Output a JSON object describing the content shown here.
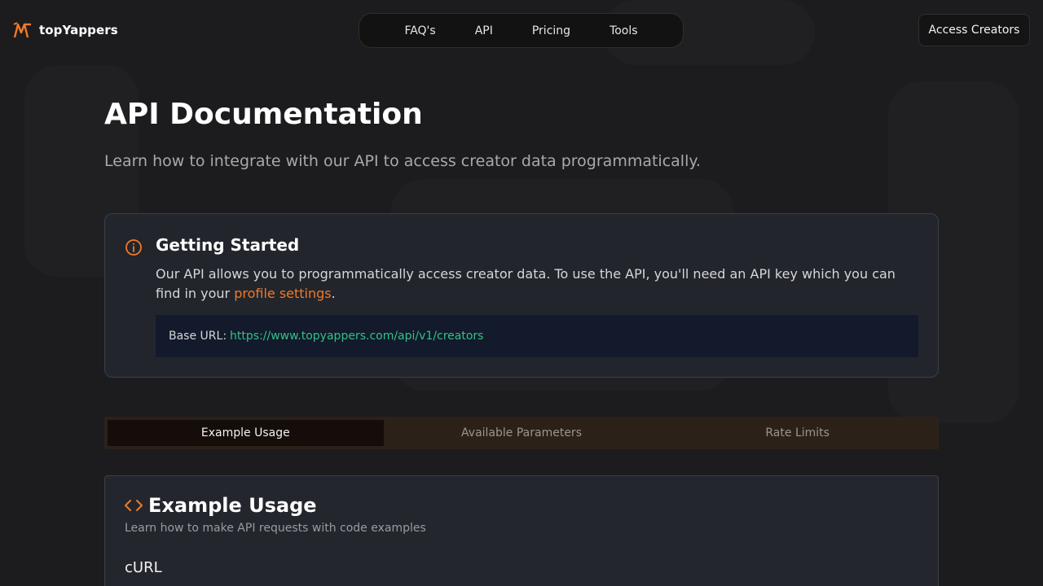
{
  "header": {
    "brand": "topYappers",
    "nav": [
      "FAQ's",
      "API",
      "Pricing",
      "Tools"
    ],
    "cta": "Access Creators"
  },
  "page": {
    "title": "API Documentation",
    "subtitle": "Learn how to integrate with our API to access creator data programmatically."
  },
  "getting_started": {
    "title": "Getting Started",
    "text_before": "Our API allows you to programmatically access creator data. To use the API, you'll need an API key which you can find in your ",
    "link": "profile settings",
    "text_after": ".",
    "base_url_label": "Base URL:",
    "base_url": "https://www.topyappers.com/api/v1/creators"
  },
  "tabs": [
    {
      "label": "Example Usage",
      "active": true
    },
    {
      "label": "Available Parameters",
      "active": false
    },
    {
      "label": "Rate Limits",
      "active": false
    }
  ],
  "example": {
    "title": "Example Usage",
    "subtitle": "Learn how to make API requests with code examples",
    "code_label": "cURL"
  },
  "colors": {
    "accent": "#f07a28",
    "url": "#34c088",
    "background": "#1c1c1e"
  },
  "icons": {
    "logo": "logo-icon",
    "info": "info-icon",
    "code": "code-icon"
  }
}
